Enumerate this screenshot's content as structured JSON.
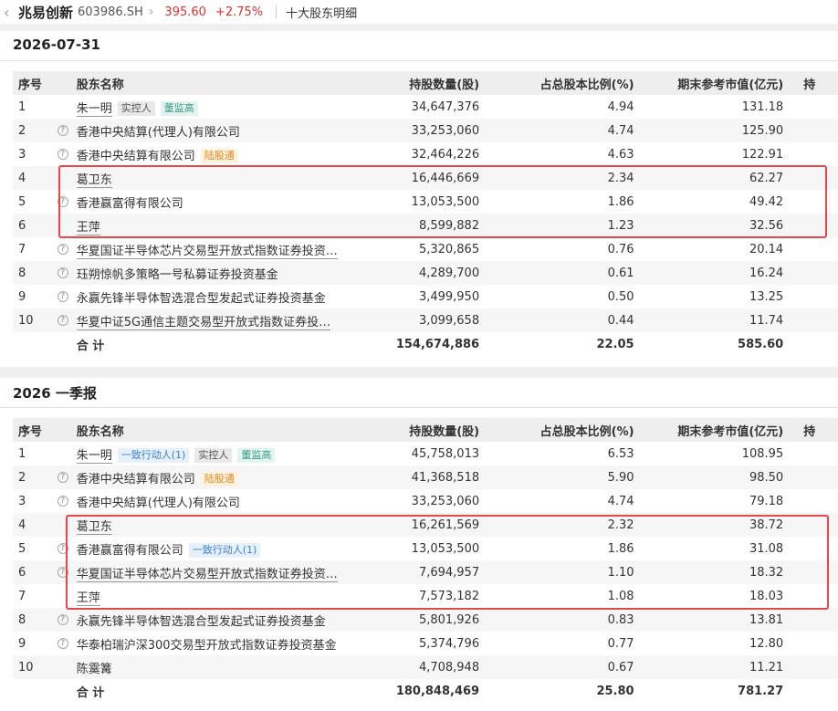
{
  "header": {
    "stock_name": "兆易创新",
    "stock_code": "603986.SH",
    "price": "395.60",
    "change_pct": "+2.75%",
    "page_title": "十大股东明细"
  },
  "columns": {
    "index": "序号",
    "holder_name": "股东名称",
    "shares": "持股数量(股)",
    "ratio": "占总股本比例(%)",
    "market_value": "期末参考市值(亿元)",
    "extra_cut": "持"
  },
  "tags": {
    "actual_controller": "实控人",
    "executive": "董监高",
    "hk_connect": "陆股通",
    "concert_party": "一致行动人(1)"
  },
  "sections": [
    {
      "title": "2026-07-31",
      "rows": [
        {
          "index": "1",
          "name": "朱一明",
          "shares": "34,647,376",
          "ratio": "4.94",
          "value": "131.18"
        },
        {
          "index": "2",
          "name": "香港中央結算(代理人)有限公司",
          "shares": "33,253,060",
          "ratio": "4.74",
          "value": "125.90"
        },
        {
          "index": "3",
          "name": "香港中央结算有限公司",
          "shares": "32,464,226",
          "ratio": "4.63",
          "value": "122.91"
        },
        {
          "index": "4",
          "name": "葛卫东",
          "shares": "16,446,669",
          "ratio": "2.34",
          "value": "62.27"
        },
        {
          "index": "5",
          "name": "香港赢富得有限公司",
          "shares": "13,053,500",
          "ratio": "1.86",
          "value": "49.42"
        },
        {
          "index": "6",
          "name": "王萍",
          "shares": "8,599,882",
          "ratio": "1.23",
          "value": "32.56"
        },
        {
          "index": "7",
          "name": "华夏国证半导体芯片交易型开放式指数证券投资…",
          "shares": "5,320,865",
          "ratio": "0.76",
          "value": "20.14"
        },
        {
          "index": "8",
          "name": "珏朔惊帆多策略一号私募证券投资基金",
          "shares": "4,289,700",
          "ratio": "0.61",
          "value": "16.24"
        },
        {
          "index": "9",
          "name": "永赢先锋半导体智选混合型发起式证券投资基金",
          "shares": "3,499,950",
          "ratio": "0.50",
          "value": "13.25"
        },
        {
          "index": "10",
          "name": "华夏中证5G通信主题交易型开放式指数证券投…",
          "shares": "3,099,658",
          "ratio": "0.44",
          "value": "11.74"
        }
      ],
      "total": {
        "label": "合 计",
        "shares": "154,674,886",
        "ratio": "22.05",
        "value": "585.60"
      }
    },
    {
      "title": "2026 一季报",
      "rows": [
        {
          "index": "1",
          "name": "朱一明",
          "shares": "45,758,013",
          "ratio": "6.53",
          "value": "108.95"
        },
        {
          "index": "2",
          "name": "香港中央结算有限公司",
          "shares": "41,368,518",
          "ratio": "5.90",
          "value": "98.50"
        },
        {
          "index": "3",
          "name": "香港中央結算(代理人)有限公司",
          "shares": "33,253,060",
          "ratio": "4.74",
          "value": "79.18"
        },
        {
          "index": "4",
          "name": "葛卫东",
          "shares": "16,261,569",
          "ratio": "2.32",
          "value": "38.72"
        },
        {
          "index": "5",
          "name": "香港赢富得有限公司",
          "shares": "13,053,500",
          "ratio": "1.86",
          "value": "31.08"
        },
        {
          "index": "6",
          "name": "华夏国证半导体芯片交易型开放式指数证券投资…",
          "shares": "7,694,957",
          "ratio": "1.10",
          "value": "18.32"
        },
        {
          "index": "7",
          "name": "王萍",
          "shares": "7,573,182",
          "ratio": "1.08",
          "value": "18.03"
        },
        {
          "index": "8",
          "name": "永赢先锋半导体智选混合型发起式证券投资基金",
          "shares": "5,801,926",
          "ratio": "0.83",
          "value": "13.81"
        },
        {
          "index": "9",
          "name": "华泰柏瑞沪深300交易型开放式指数证券投资基金",
          "shares": "5,374,796",
          "ratio": "0.77",
          "value": "12.80"
        },
        {
          "index": "10",
          "name": "陈霙篝",
          "shares": "4,708,948",
          "ratio": "0.67",
          "value": "11.21"
        }
      ],
      "total": {
        "label": "合 计",
        "shares": "180,848,469",
        "ratio": "25.80",
        "value": "781.27"
      }
    }
  ],
  "colors": {
    "accent_red": "#e0302c",
    "highlight_box": "#e5484d"
  }
}
